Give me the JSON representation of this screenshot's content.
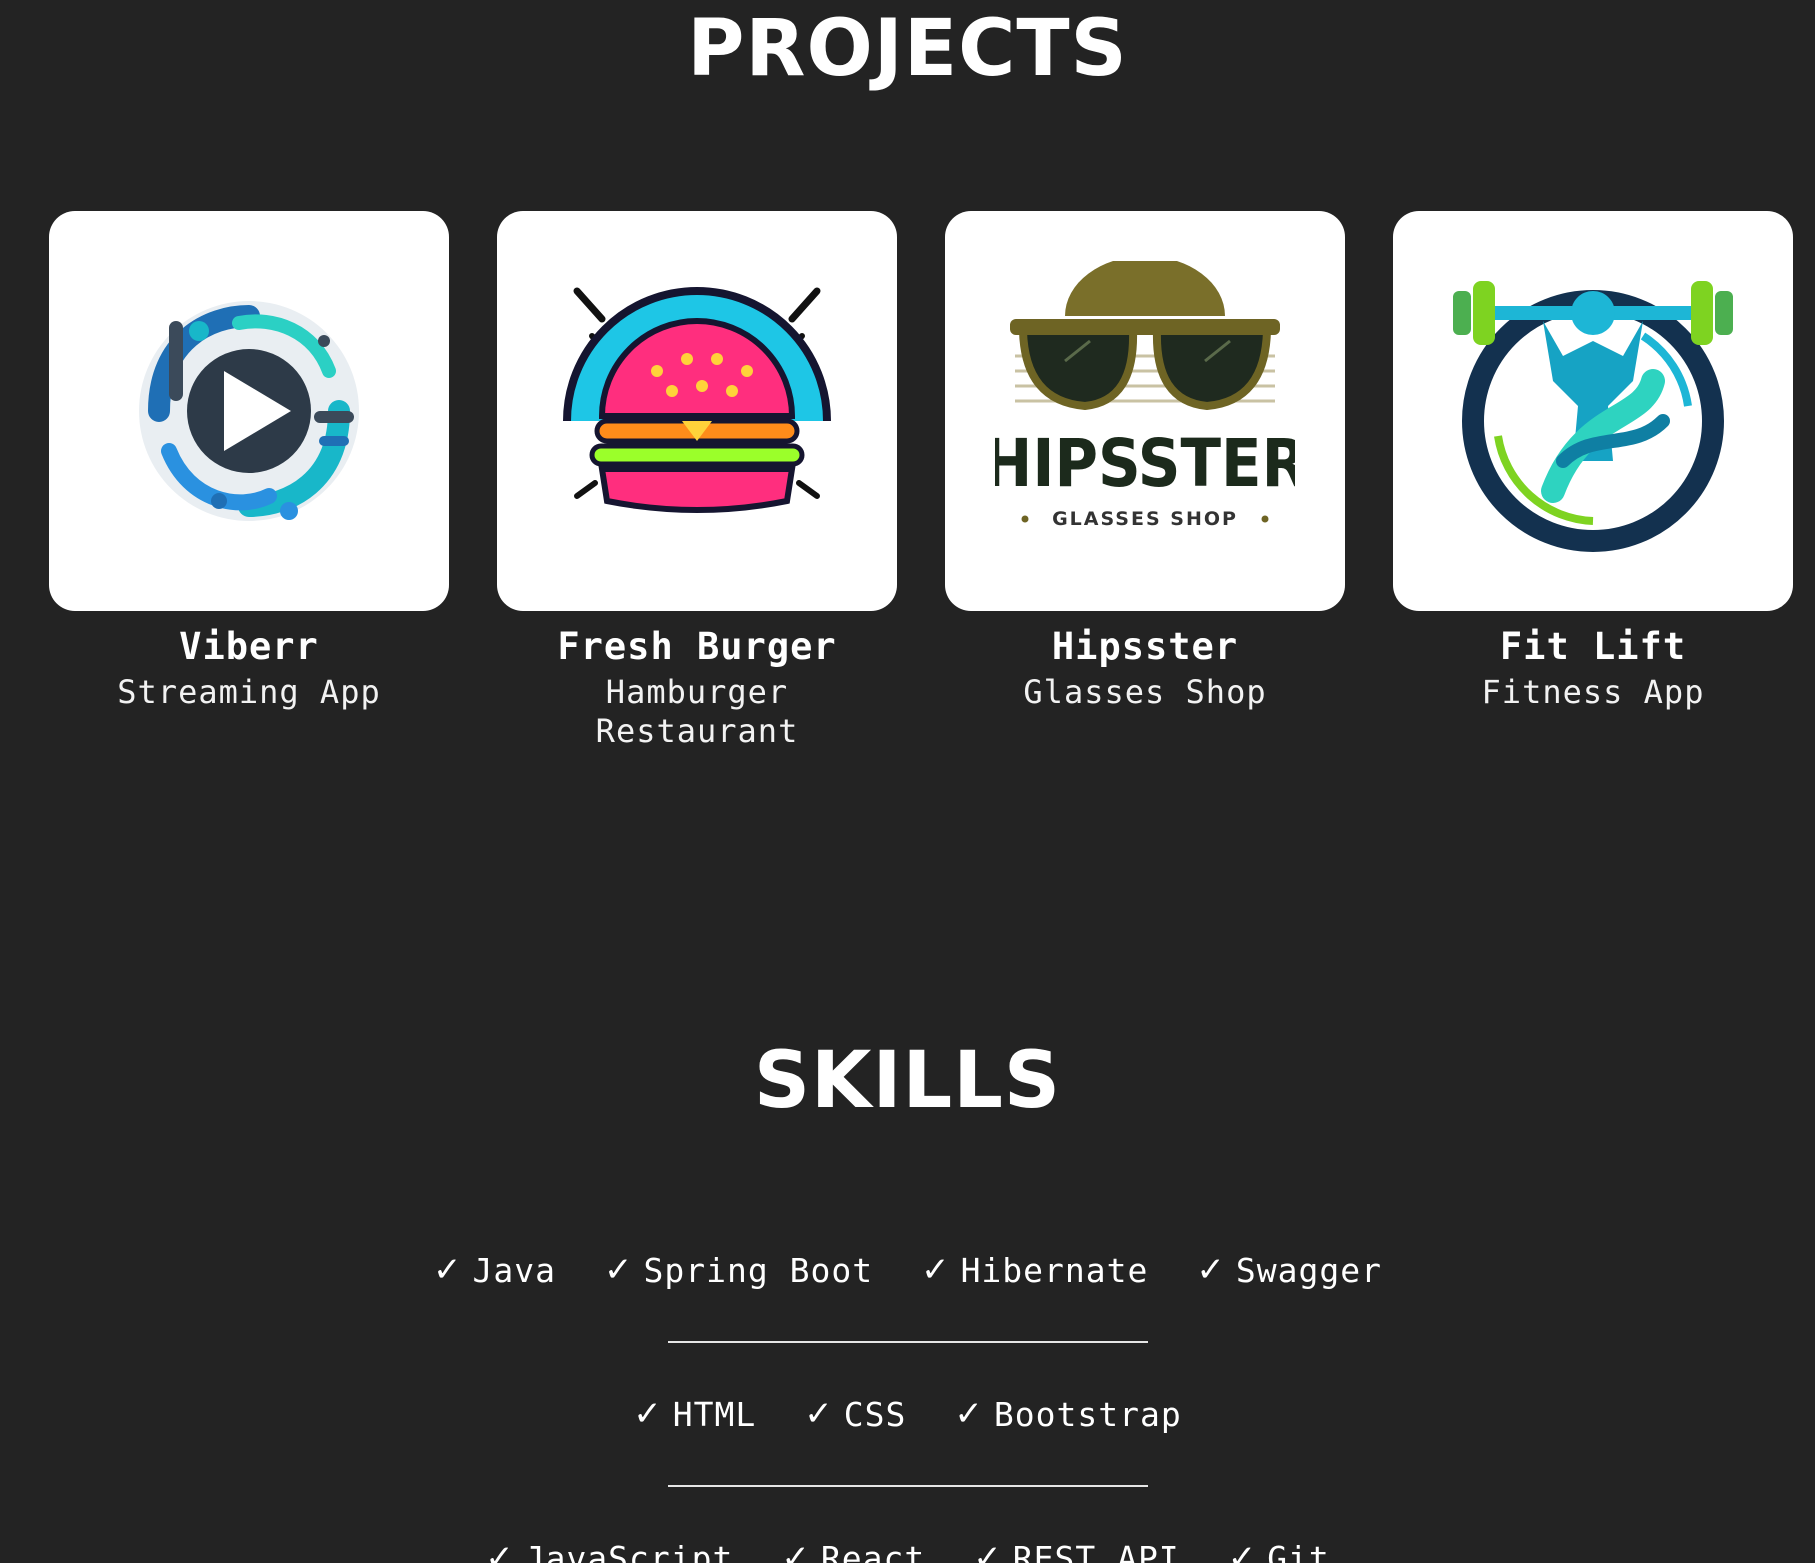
{
  "projects": {
    "title": "PROJECTS",
    "items": [
      {
        "name": "Viberr",
        "subtitle": "Streaming App",
        "logo_icon": "streaming-play-logo-icon"
      },
      {
        "name": "Fresh Burger",
        "subtitle": "Hamburger Restaurant",
        "logo_icon": "burger-logo-icon"
      },
      {
        "name": "Hipsster",
        "subtitle": "Glasses Shop",
        "logo_icon": "sunglasses-logo-icon",
        "logo_text": "HIPSSTER",
        "logo_subtext": "GLASSES SHOP"
      },
      {
        "name": "Fit Lift",
        "subtitle": "Fitness App",
        "logo_icon": "dumbbell-logo-icon"
      }
    ]
  },
  "skills": {
    "title": "SKILLS",
    "check_glyph": "✓",
    "rows": [
      [
        "Java",
        "Spring Boot",
        "Hibernate",
        "Swagger"
      ],
      [
        "HTML",
        "CSS",
        "Bootstrap"
      ],
      [
        "JavaScript",
        "React",
        "REST API",
        "Git"
      ]
    ]
  },
  "colors": {
    "background": "#232323",
    "text": "#ffffff",
    "card": "#ffffff"
  }
}
